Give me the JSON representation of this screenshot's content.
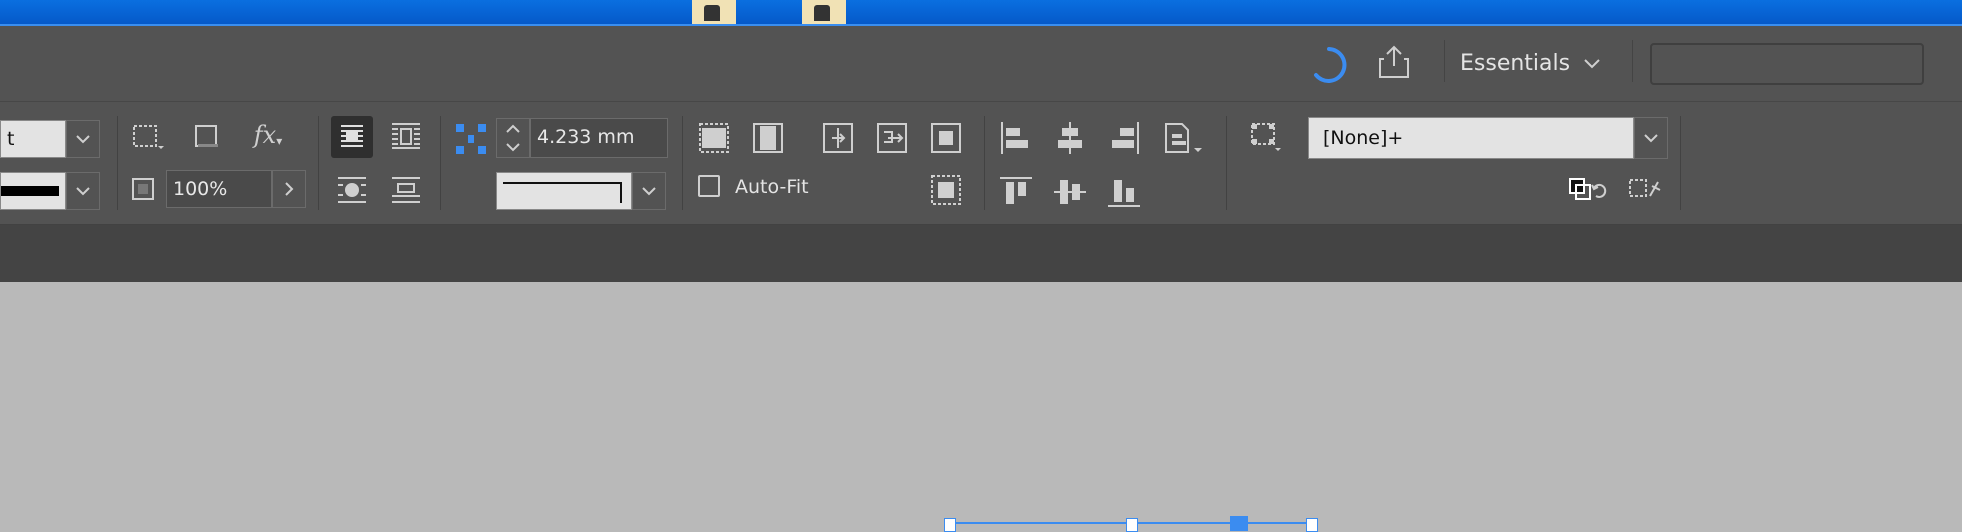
{
  "workspace": {
    "label": "Essentials"
  },
  "search": {
    "value": ""
  },
  "control": {
    "font_style_partial": "t",
    "opacity_value": "100%",
    "gap_value": "4.233 mm",
    "auto_fit_label": "Auto-Fit",
    "auto_fit_checked": false,
    "object_style_value": "[None]+"
  },
  "colors": {
    "accent": "#3b8cf0",
    "panel": "#535353",
    "taskbar": "#0a6fe0",
    "canvas": "#b9b9b9"
  }
}
